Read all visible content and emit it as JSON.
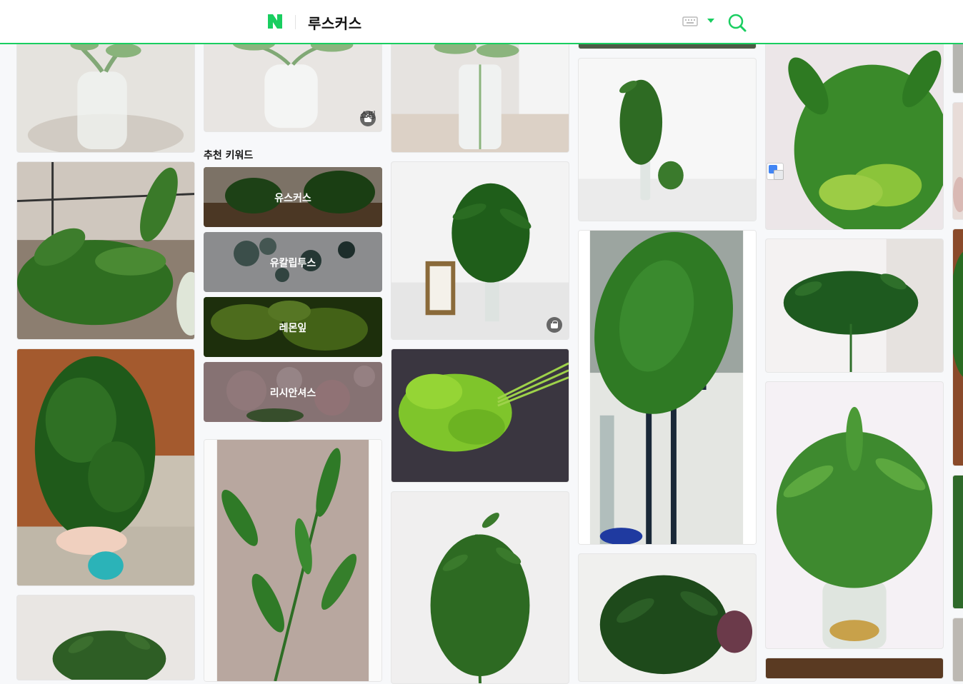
{
  "header": {
    "query": "루스커스",
    "logo_letter": "N",
    "brand_color": "#19ce60",
    "icons": [
      "keyboard-icon",
      "chevron-down-icon",
      "search-icon"
    ]
  },
  "recommended_keywords": {
    "title": "추천 키워드",
    "items": [
      {
        "label": "유스커스"
      },
      {
        "label": "유칼립투스"
      },
      {
        "label": "레몬잎"
      },
      {
        "label": "리시안셔스"
      }
    ]
  },
  "badges": {
    "shopping_label": "쇼핑"
  }
}
